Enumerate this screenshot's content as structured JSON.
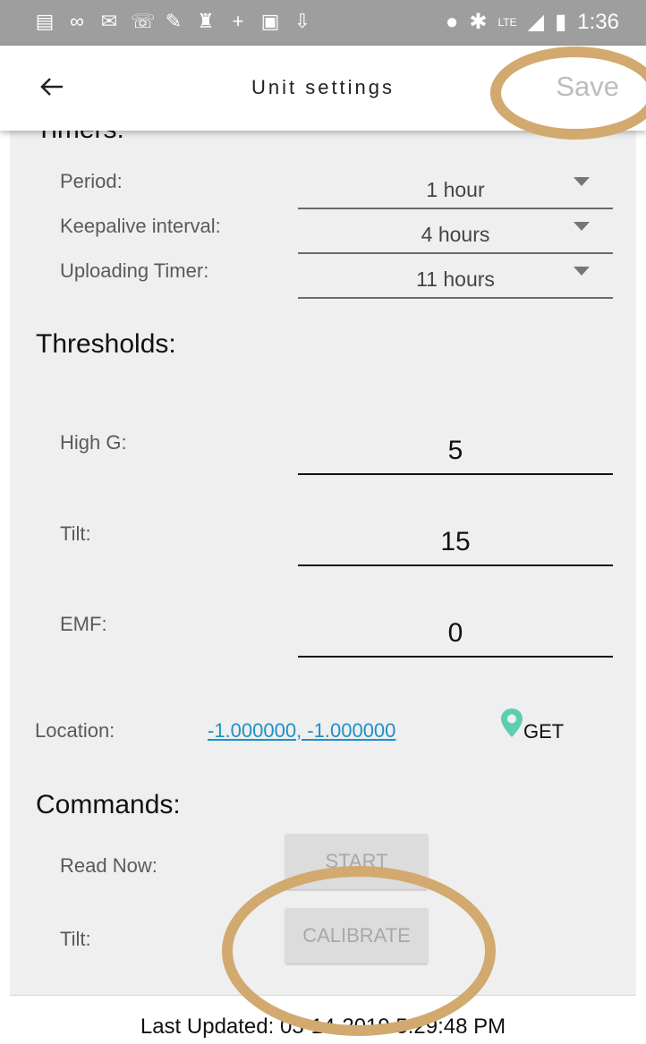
{
  "status_bar": {
    "time": "1:36",
    "network": "LTE",
    "icons_left": [
      "notes-icon",
      "voicemail-icon",
      "mail-icon",
      "missed-call-icon",
      "wrench-icon",
      "keyhole-icon",
      "crosshair-icon",
      "image-icon",
      "download-icon"
    ],
    "icons_right": [
      "location-pin-icon",
      "bluetooth-icon",
      "signal-icon",
      "battery-icon"
    ]
  },
  "app_bar": {
    "title": "Unit settings",
    "save_label": "Save"
  },
  "timers": {
    "section_title": "Timers:",
    "rows": [
      {
        "label": "Period:",
        "value": "1 hour"
      },
      {
        "label": "Keepalive interval:",
        "value": "4 hours"
      },
      {
        "label": "Uploading Timer:",
        "value": "11 hours"
      }
    ]
  },
  "thresholds": {
    "section_title": "Thresholds:",
    "rows": [
      {
        "label": "High G:",
        "value": "5"
      },
      {
        "label": "Tilt:",
        "value": "15"
      },
      {
        "label": "EMF:",
        "value": "0"
      }
    ]
  },
  "location": {
    "label": "Location:",
    "value": "-1.000000, -1.000000",
    "get_label": "GET"
  },
  "commands": {
    "section_title": "Commands:",
    "rows": [
      {
        "label": "Read Now:",
        "button": "START"
      },
      {
        "label": "Tilt:",
        "button": "CALIBRATE"
      }
    ]
  },
  "footer": {
    "last_updated": "Last Updated: 03-14-2019 5:29:48 PM"
  },
  "colors": {
    "annotation_circle": "#d2a96f",
    "link": "#1e90c8",
    "pin": "#5ccfb0"
  }
}
